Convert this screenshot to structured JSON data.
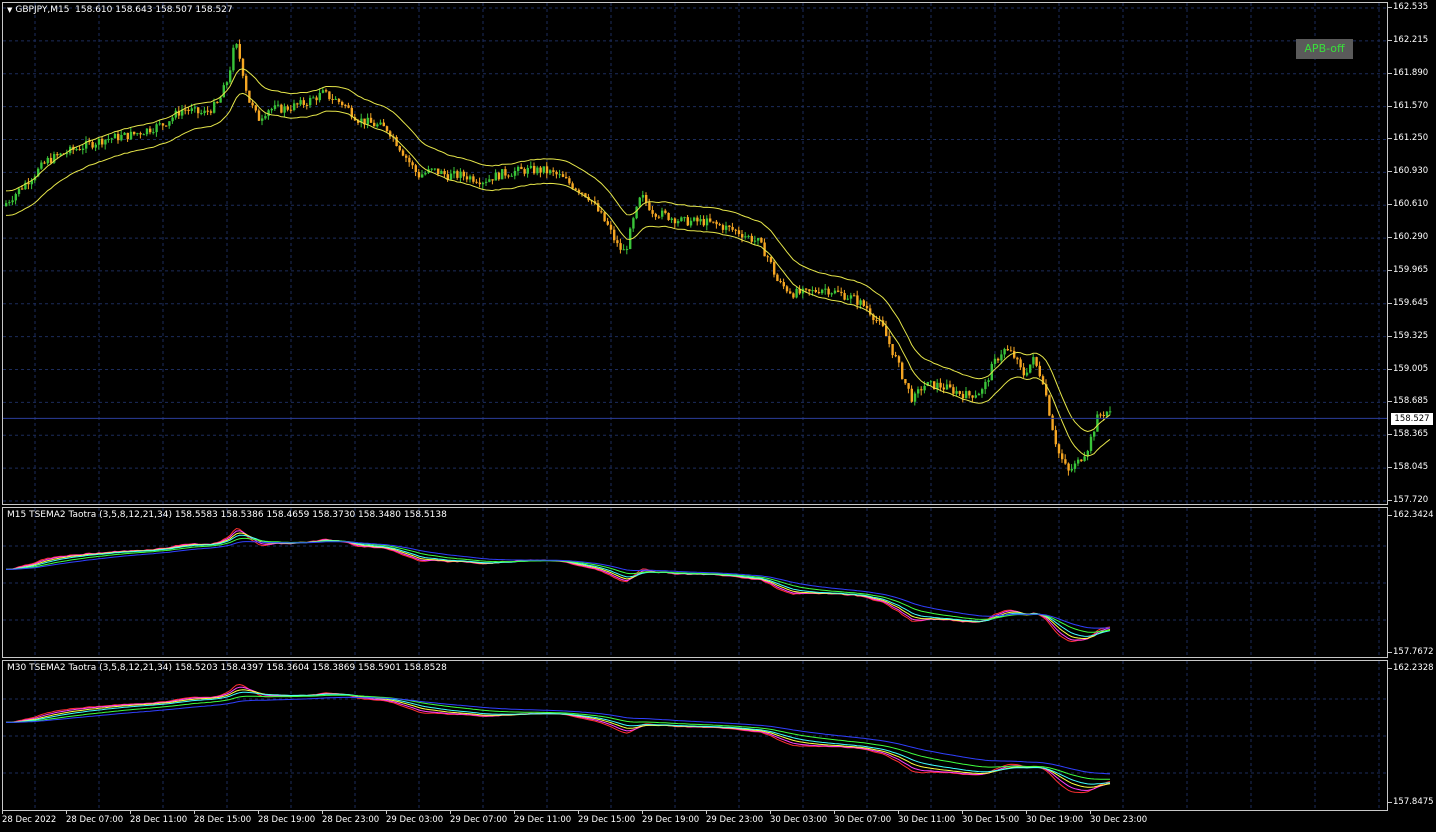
{
  "main": {
    "symbol_label": "GBPJPY,M15",
    "ohlc_label": "158.610 158.643 158.507 158.527",
    "apb_label": "APB-off",
    "current_price": "158.527",
    "price_ticks": [
      "162.535",
      "162.215",
      "161.890",
      "161.570",
      "161.250",
      "160.930",
      "160.610",
      "160.290",
      "159.965",
      "159.645",
      "159.325",
      "159.005",
      "158.685",
      "158.365",
      "158.045",
      "157.720"
    ],
    "colors": {
      "bull": "#39c439",
      "bear": "#f5a623",
      "band": "#e6e64a",
      "grid": "#1c2c5c",
      "pricebar": "#2c3e9c"
    }
  },
  "indicator_m15": {
    "label": "M15 TSEMA2 Taotra (3,5,8,12,21,34) 158.5583 158.5386 158.4659 158.3730 158.3480 158.5138",
    "top_tick": "162.3424",
    "bottom_tick": "157.7672"
  },
  "indicator_m30": {
    "label": "M30 TSEMA2 Taotra (3,5,8,12,21,34) 158.5203 158.4397 158.3604 158.3869 158.5901 158.8528",
    "top_tick": "162.2328",
    "bottom_tick": "157.8475"
  },
  "ema_colors": [
    "#ff3030",
    "#ff40ff",
    "#ffff40",
    "#40ffff",
    "#40ff40",
    "#3040ff"
  ],
  "time_axis": [
    "28 Dec 2022",
    "28 Dec 07:00",
    "28 Dec 11:00",
    "28 Dec 15:00",
    "28 Dec 19:00",
    "28 Dec 23:00",
    "29 Dec 03:00",
    "29 Dec 07:00",
    "29 Dec 11:00",
    "29 Dec 15:00",
    "29 Dec 19:00",
    "29 Dec 23:00",
    "30 Dec 03:00",
    "30 Dec 07:00",
    "30 Dec 11:00",
    "30 Dec 15:00",
    "30 Dec 19:00",
    "30 Dec 23:00"
  ],
  "chart_data": {
    "type": "candlestick",
    "symbol": "GBPJPY",
    "timeframe": "M15",
    "ylim": [
      157.72,
      162.535
    ],
    "last_close": 158.527,
    "close_path": [
      [
        0,
        160.6
      ],
      [
        20,
        160.8
      ],
      [
        45,
        161.05
      ],
      [
        70,
        161.15
      ],
      [
        100,
        161.25
      ],
      [
        130,
        161.3
      ],
      [
        160,
        161.4
      ],
      [
        180,
        161.55
      ],
      [
        200,
        161.5
      ],
      [
        215,
        161.6
      ],
      [
        225,
        161.85
      ],
      [
        232,
        162.2
      ],
      [
        238,
        162.0
      ],
      [
        245,
        161.65
      ],
      [
        255,
        161.45
      ],
      [
        265,
        161.55
      ],
      [
        280,
        161.55
      ],
      [
        300,
        161.6
      ],
      [
        320,
        161.7
      ],
      [
        340,
        161.6
      ],
      [
        355,
        161.45
      ],
      [
        370,
        161.4
      ],
      [
        385,
        161.35
      ],
      [
        395,
        161.2
      ],
      [
        405,
        161.05
      ],
      [
        415,
        160.9
      ],
      [
        430,
        160.95
      ],
      [
        445,
        160.9
      ],
      [
        460,
        160.9
      ],
      [
        480,
        160.85
      ],
      [
        500,
        160.92
      ],
      [
        520,
        160.95
      ],
      [
        540,
        160.95
      ],
      [
        555,
        160.9
      ],
      [
        570,
        160.8
      ],
      [
        585,
        160.7
      ],
      [
        595,
        160.55
      ],
      [
        605,
        160.4
      ],
      [
        615,
        160.2
      ],
      [
        622,
        160.15
      ],
      [
        630,
        160.45
      ],
      [
        638,
        160.7
      ],
      [
        650,
        160.55
      ],
      [
        665,
        160.5
      ],
      [
        680,
        160.45
      ],
      [
        700,
        160.45
      ],
      [
        720,
        160.4
      ],
      [
        735,
        160.35
      ],
      [
        745,
        160.3
      ],
      [
        755,
        160.25
      ],
      [
        765,
        160.1
      ],
      [
        775,
        159.85
      ],
      [
        790,
        159.75
      ],
      [
        805,
        159.75
      ],
      [
        820,
        159.8
      ],
      [
        835,
        159.75
      ],
      [
        850,
        159.7
      ],
      [
        865,
        159.6
      ],
      [
        880,
        159.4
      ],
      [
        893,
        159.1
      ],
      [
        903,
        158.85
      ],
      [
        910,
        158.7
      ],
      [
        920,
        158.85
      ],
      [
        935,
        158.85
      ],
      [
        950,
        158.8
      ],
      [
        965,
        158.75
      ],
      [
        980,
        158.8
      ],
      [
        990,
        159.05
      ],
      [
        1000,
        159.2
      ],
      [
        1010,
        159.15
      ],
      [
        1020,
        158.95
      ],
      [
        1030,
        159.1
      ],
      [
        1040,
        158.9
      ],
      [
        1048,
        158.5
      ],
      [
        1055,
        158.2
      ],
      [
        1065,
        158.0
      ],
      [
        1075,
        158.1
      ],
      [
        1085,
        158.25
      ],
      [
        1095,
        158.55
      ],
      [
        1105,
        158.6
      ],
      [
        1110,
        158.527
      ]
    ]
  }
}
